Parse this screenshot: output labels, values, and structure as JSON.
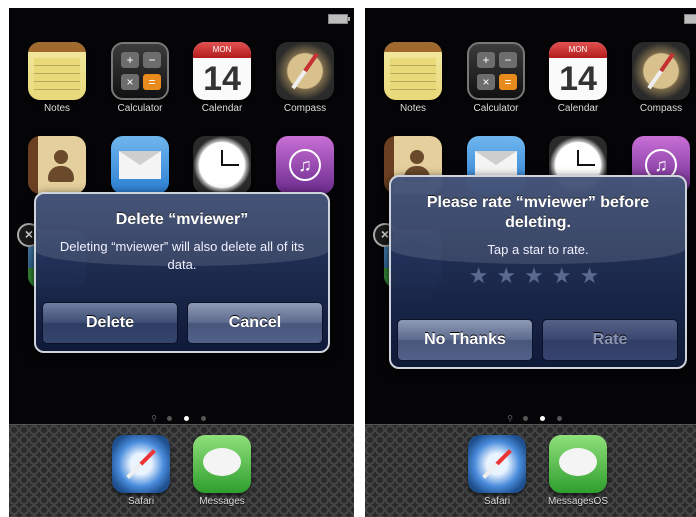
{
  "screens": [
    {
      "apps_row1": [
        "Notes",
        "Calculator",
        "Calendar",
        "Compass"
      ],
      "apps_row2_dimmed": [
        "Contacts",
        "Mail",
        "Clock",
        "iTunes"
      ],
      "app_hidden_label": "mviewer",
      "calendar": {
        "weekday": "MON",
        "day": "14"
      },
      "dock": [
        "Safari",
        "Messages"
      ],
      "page_indicator": {
        "pages": 3,
        "current": 2
      },
      "alert": {
        "title": "Delete “mviewer”",
        "message": "Deleting “mviewer” will also delete all of its data.",
        "buttons": [
          "Delete",
          "Cancel"
        ]
      }
    },
    {
      "apps_row1": [
        "Notes",
        "Calculator",
        "Calendar",
        "Compass"
      ],
      "app_hidden_label": "mviewer",
      "calendar": {
        "weekday": "MON",
        "day": "14"
      },
      "dock": [
        "Safari",
        "MessagesOS"
      ],
      "page_indicator": {
        "pages": 3,
        "current": 2
      },
      "alert": {
        "title": "Please rate “mviewer” before deleting.",
        "message": "Tap a star to rate.",
        "stars": "★★★★★",
        "rating": 0,
        "buttons": [
          "No Thanks",
          "Rate"
        ]
      }
    }
  ],
  "calculator_keys": [
    "+",
    "−",
    "×",
    "="
  ],
  "icons": {
    "delete_badge": "x-circle-icon",
    "itunes": "music-note-icon"
  }
}
